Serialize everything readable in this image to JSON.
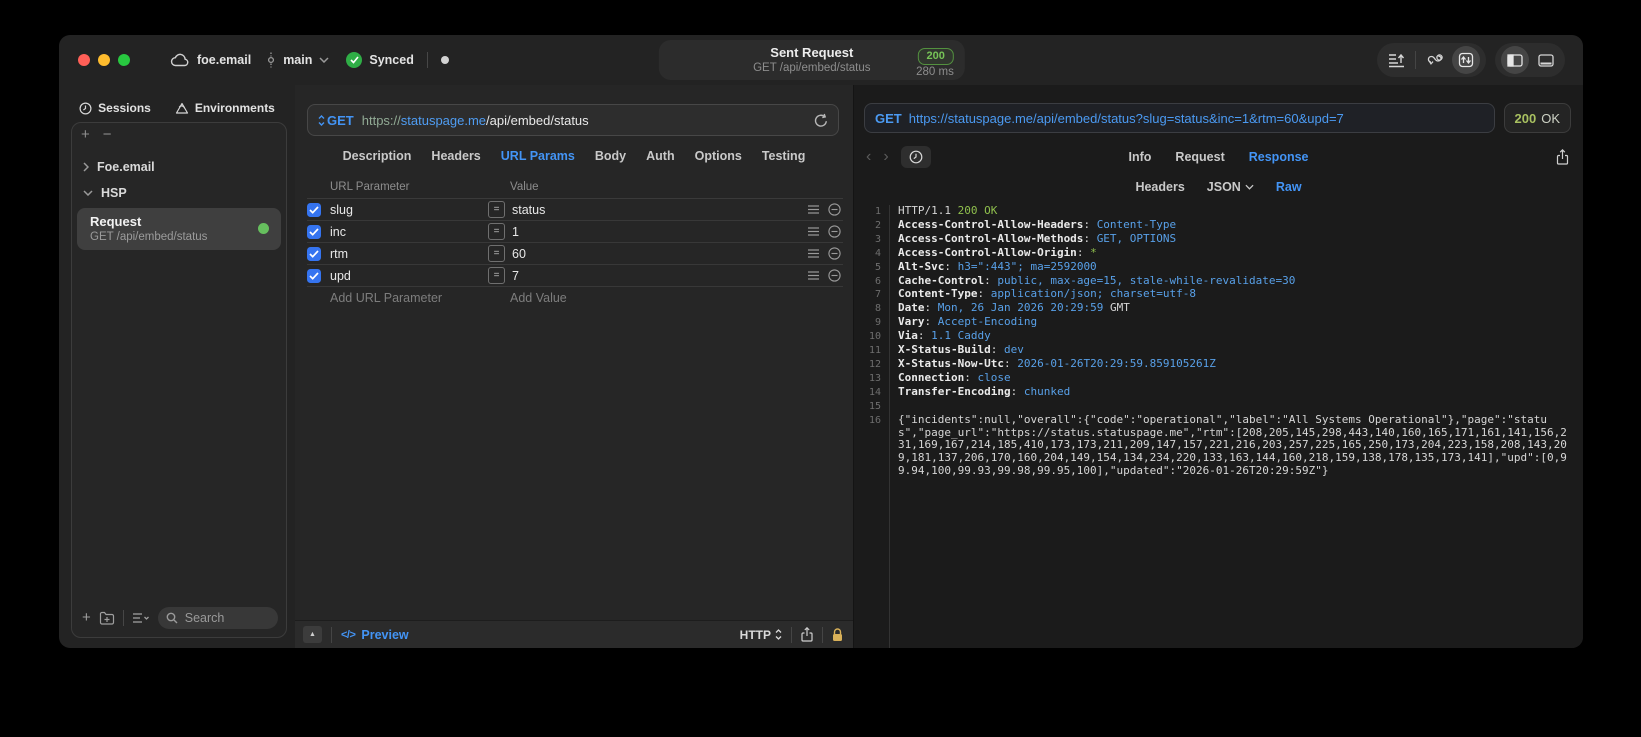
{
  "titlebar": {
    "project": "foe.email",
    "branch": "main",
    "sync_label": "Synced",
    "request_title": "Sent Request",
    "request_subtitle": "GET /api/embed/status",
    "status_code": "200",
    "duration": "280 ms"
  },
  "sidebar": {
    "tab_sessions": "Sessions",
    "tab_environments": "Environments",
    "group_collapsed": "Foe.email",
    "group_expanded": "HSP",
    "request_item": {
      "title": "Request",
      "subtitle": "GET /api/embed/status"
    },
    "search_placeholder": "Search"
  },
  "editor": {
    "method": "GET",
    "url_scheme": "https://",
    "url_host": "statuspage.me",
    "url_path": "/api/embed/status",
    "tabs": [
      "Description",
      "Headers",
      "URL Params",
      "Body",
      "Auth",
      "Options",
      "Testing"
    ],
    "active_tab": "URL Params",
    "table": {
      "col_param": "URL Parameter",
      "col_value": "Value",
      "rows": [
        {
          "name": "slug",
          "value": "status",
          "checked": true
        },
        {
          "name": "inc",
          "value": "1",
          "checked": true
        },
        {
          "name": "rtm",
          "value": "60",
          "checked": true
        },
        {
          "name": "upd",
          "value": "7",
          "checked": true
        }
      ],
      "add_param": "Add URL Parameter",
      "add_value": "Add Value"
    },
    "footer": {
      "preview_icon": "</>",
      "preview": "Preview",
      "protocol": "HTTP"
    }
  },
  "response": {
    "method": "GET",
    "url": "https://statuspage.me/api/embed/status?slug=status&inc=1&rtm=60&upd=7",
    "status_code": "200",
    "status_text": "OK",
    "tabs": [
      "Info",
      "Request",
      "Response"
    ],
    "active_tab": "Response",
    "subtabs": [
      "Headers",
      "JSON",
      "Raw"
    ],
    "active_subtab": "Raw",
    "lines": [
      {
        "n": "1",
        "seg": [
          [
            "HTTP/1.1 ",
            "p"
          ],
          [
            "200 OK",
            "g"
          ]
        ]
      },
      {
        "n": "2",
        "seg": [
          [
            "Access-Control-Allow-Headers",
            "k"
          ],
          [
            ": ",
            "p"
          ],
          [
            "Content-Type",
            "v"
          ]
        ]
      },
      {
        "n": "3",
        "seg": [
          [
            "Access-Control-Allow-Methods",
            "k"
          ],
          [
            ": ",
            "p"
          ],
          [
            "GET, OPTIONS",
            "v"
          ]
        ]
      },
      {
        "n": "4",
        "seg": [
          [
            "Access-Control-Allow-Origin",
            "k"
          ],
          [
            ": ",
            "p"
          ],
          [
            "*",
            "g"
          ]
        ]
      },
      {
        "n": "5",
        "seg": [
          [
            "Alt-Svc",
            "k"
          ],
          [
            ": ",
            "p"
          ],
          [
            "h3=\":443\"; ma=2592000",
            "v"
          ]
        ]
      },
      {
        "n": "6",
        "seg": [
          [
            "Cache-Control",
            "k"
          ],
          [
            ": ",
            "p"
          ],
          [
            "public, max-age=15, stale-while-revalidate=30",
            "v"
          ]
        ]
      },
      {
        "n": "7",
        "seg": [
          [
            "Content-Type",
            "k"
          ],
          [
            ": ",
            "p"
          ],
          [
            "application/json; charset=utf-8",
            "v"
          ]
        ]
      },
      {
        "n": "8",
        "seg": [
          [
            "Date",
            "k"
          ],
          [
            ": ",
            "p"
          ],
          [
            "Mon, 26 Jan 2026 20:29:59",
            "v"
          ],
          [
            " GMT",
            "p"
          ]
        ]
      },
      {
        "n": "9",
        "seg": [
          [
            "Vary",
            "k"
          ],
          [
            ": ",
            "p"
          ],
          [
            "Accept-Encoding",
            "v"
          ]
        ]
      },
      {
        "n": "10",
        "seg": [
          [
            "Via",
            "k"
          ],
          [
            ": ",
            "p"
          ],
          [
            "1.1 Caddy",
            "v"
          ]
        ]
      },
      {
        "n": "11",
        "seg": [
          [
            "X-Status-Build",
            "k"
          ],
          [
            ": ",
            "p"
          ],
          [
            "dev",
            "v"
          ]
        ]
      },
      {
        "n": "12",
        "seg": [
          [
            "X-Status-Now-Utc",
            "k"
          ],
          [
            ": ",
            "p"
          ],
          [
            "2026-01-26T20:29:59.859105261Z",
            "v"
          ]
        ]
      },
      {
        "n": "13",
        "seg": [
          [
            "Connection",
            "k"
          ],
          [
            ": ",
            "p"
          ],
          [
            "close",
            "v"
          ]
        ]
      },
      {
        "n": "14",
        "seg": [
          [
            "Transfer-Encoding",
            "k"
          ],
          [
            ": ",
            "p"
          ],
          [
            "chunked",
            "v"
          ]
        ]
      },
      {
        "n": "15",
        "seg": []
      },
      {
        "n": "16",
        "seg": [
          [
            "{\"incidents\":null,\"overall\":{\"code\":\"operational\",\"label\":\"All Systems Operational\"},\"page\":\"status\",\"page_url\":\"https://status.statuspage.me\",\"rtm\":[208,205,145,298,443,140,160,165,171,161,141,156,231,169,167,214,185,410,173,173,211,209,147,157,221,216,203,257,225,165,250,173,204,223,158,208,143,209,181,137,206,170,160,204,149,154,134,234,220,133,163,144,160,218,159,138,178,135,173,141],\"upd\":[0,99.94,100,99.93,99.98,99.95,100],\"updated\":\"2026-01-26T20:29:59Z\"}",
            "p"
          ]
        ]
      }
    ]
  },
  "glyphs": {
    "plus": "+",
    "minus": "−",
    "tri_up": "▲",
    "arrow_back": "‹",
    "arrow_fwd": "›"
  },
  "colors": {
    "accent_blue": "#4394f5",
    "status_green": "#8fbf4d",
    "badge_green": "#76c457",
    "checkbox_blue": "#3574f0"
  }
}
